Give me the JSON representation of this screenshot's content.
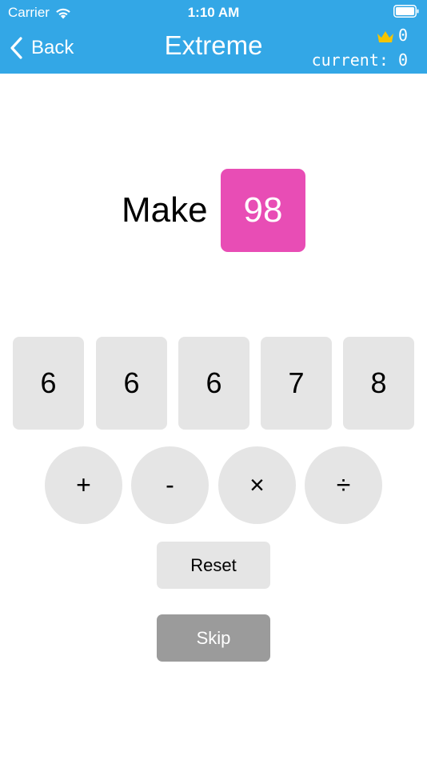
{
  "status_bar": {
    "carrier": "Carrier",
    "time": "1:10 AM"
  },
  "nav": {
    "back_label": "Back",
    "title": "Extreme",
    "best_score": "0",
    "current_label": "current:",
    "current_score": "0"
  },
  "puzzle": {
    "make_label": "Make",
    "target": "98"
  },
  "numbers": [
    "6",
    "6",
    "6",
    "7",
    "8"
  ],
  "operators": [
    "+",
    "-",
    "×",
    "÷"
  ],
  "actions": {
    "reset_label": "Reset",
    "skip_label": "Skip"
  },
  "colors": {
    "nav_bar": "#33A7E6",
    "target_tile": "#E84DB5",
    "crown": "#F5C400",
    "tile": "#E5E5E5",
    "skip": "#9B9B9B"
  },
  "icons": {
    "wifi": "wifi-icon",
    "battery": "battery-icon",
    "back": "chevron-left-icon",
    "crown": "crown-icon"
  }
}
